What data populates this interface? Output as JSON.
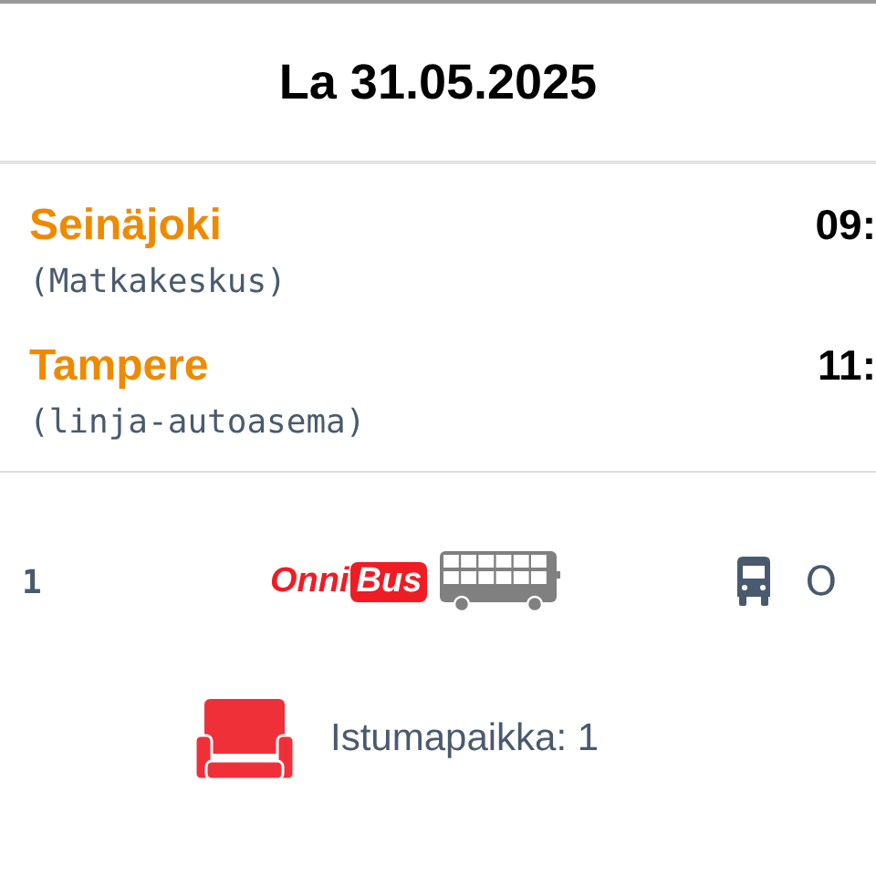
{
  "date": "La 31.05.2025",
  "stops": [
    {
      "city": "Seinäjoki",
      "station": "(Matkakeskus)",
      "time": "09:"
    },
    {
      "city": "Tampere",
      "station": "(linja-autoasema)",
      "time": "11:"
    }
  ],
  "vehicle": {
    "number": "1",
    "logo_first": "Onni",
    "logo_second": "Bus",
    "type_text": "O"
  },
  "seat": {
    "label": "Istumapaikka: 1"
  }
}
